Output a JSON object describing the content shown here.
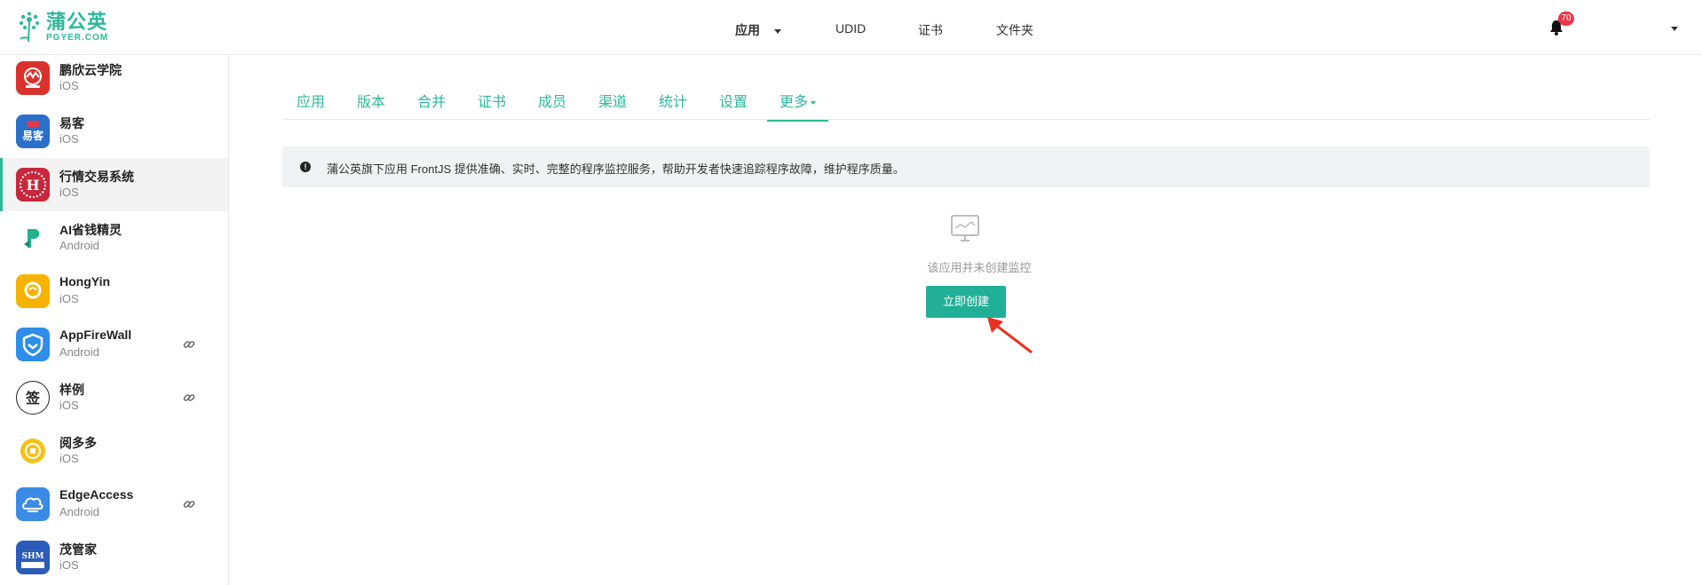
{
  "brand": {
    "name_cn": "蒲公英",
    "name_en": "PGYER.COM",
    "color": "#2fb89a"
  },
  "topnav": {
    "items": [
      {
        "label": "应用",
        "has_dropdown": true
      },
      {
        "label": "UDID"
      },
      {
        "label": "证书"
      },
      {
        "label": "文件夹"
      }
    ],
    "notification_count": "70"
  },
  "sidebar": {
    "apps": [
      {
        "name": "鹏欣云学院",
        "platform": "iOS",
        "icon": "app-icon-pengxin",
        "icon_color": "#d9322d",
        "linked": false
      },
      {
        "name": "易客",
        "platform": "iOS",
        "icon": "app-icon-yike",
        "icon_color": "#2a6fc9",
        "linked": false
      },
      {
        "name": "行情交易系统",
        "platform": "iOS",
        "icon": "app-icon-hangqing",
        "icon_color": "#c8283c",
        "linked": false,
        "active": true
      },
      {
        "name": "AI省钱精灵",
        "platform": "Android",
        "icon": "app-icon-ai",
        "icon_color": "#1fb38a",
        "linked": false
      },
      {
        "name": "HongYin",
        "platform": "iOS",
        "icon": "app-icon-hongyin",
        "icon_color": "#f5b300",
        "linked": false
      },
      {
        "name": "AppFireWall",
        "platform": "Android",
        "icon": "app-icon-firewall",
        "icon_color": "#2e8ee8",
        "linked": true
      },
      {
        "name": "样例",
        "platform": "iOS",
        "icon": "app-icon-sample",
        "icon_color": "#ffffff",
        "linked": true
      },
      {
        "name": "阅多多",
        "platform": "iOS",
        "icon": "app-icon-yueduoduo",
        "icon_color": "#f3c21a",
        "linked": false
      },
      {
        "name": "EdgeAccess",
        "platform": "Android",
        "icon": "app-icon-edge",
        "icon_color": "#3b8be6",
        "linked": true
      },
      {
        "name": "茂管家",
        "platform": "iOS",
        "icon": "app-icon-mao",
        "icon_color": "#2b5cb8",
        "linked": false
      }
    ]
  },
  "tabs": [
    {
      "label": "应用"
    },
    {
      "label": "版本"
    },
    {
      "label": "合并"
    },
    {
      "label": "证书"
    },
    {
      "label": "成员"
    },
    {
      "label": "渠道"
    },
    {
      "label": "统计"
    },
    {
      "label": "设置"
    },
    {
      "label": "更多",
      "active": true,
      "has_dropdown": true
    }
  ],
  "notice": {
    "text": "蒲公英旗下应用 FrontJS 提供准确、实时、完整的程序监控服务，帮助开发者快速追踪程序故障，维护程序质量。"
  },
  "empty_state": {
    "icon": "monitor-icon",
    "text": "该应用并未创建监控",
    "button_label": "立即创建"
  }
}
